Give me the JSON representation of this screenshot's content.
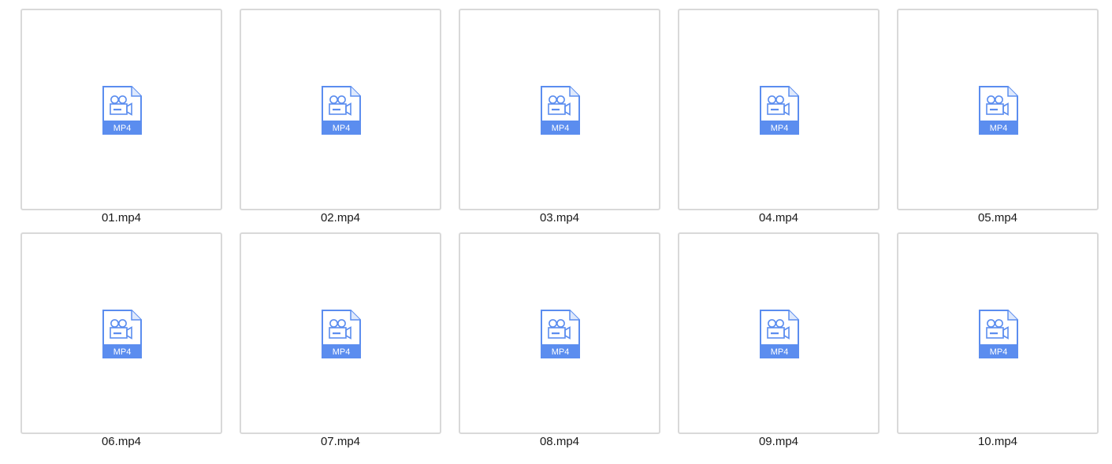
{
  "files": [
    {
      "name": "01.mp4",
      "type_label": "MP4"
    },
    {
      "name": "02.mp4",
      "type_label": "MP4"
    },
    {
      "name": "03.mp4",
      "type_label": "MP4"
    },
    {
      "name": "04.mp4",
      "type_label": "MP4"
    },
    {
      "name": "05.mp4",
      "type_label": "MP4"
    },
    {
      "name": "06.mp4",
      "type_label": "MP4"
    },
    {
      "name": "07.mp4",
      "type_label": "MP4"
    },
    {
      "name": "08.mp4",
      "type_label": "MP4"
    },
    {
      "name": "09.mp4",
      "type_label": "MP4"
    },
    {
      "name": "10.mp4",
      "type_label": "MP4"
    }
  ],
  "icon": {
    "name": "video-file-icon",
    "accent_color": "#5b8def"
  },
  "colors": {
    "background": "#ffffff",
    "tile_border": "#d9d9d9",
    "text": "#1a1a1a"
  }
}
